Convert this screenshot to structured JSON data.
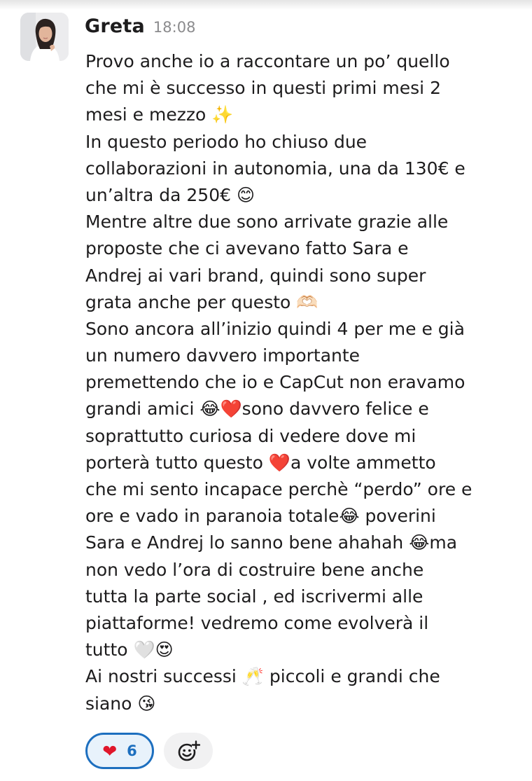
{
  "message": {
    "sender": "Greta",
    "time": "18:08",
    "lines": [
      "Provo anche io a raccontare un po’ quello",
      "che mi è successo in questi primi mesi 2",
      "mesi e mezzo ✨",
      "In questo periodo ho chiuso due",
      "collaborazioni in autonomia, una da 130€ e",
      "un’altra da 250€ 😊",
      "Mentre altre due sono arrivate grazie alle",
      "proposte che ci avevano fatto Sara e",
      "Andrej ai vari brand, quindi sono super",
      "grata anche per questo 🫶🏻",
      "Sono ancora all’inizio quindi 4 per me e già",
      "un numero davvero importante",
      "premettendo che io e CapCut non eravamo",
      "grandi amici 😂❤️sono davvero felice e",
      "soprattutto curiosa di vedere dove mi",
      "porterà tutto questo ❤️a volte ammetto",
      "che mi sento incapace perchè “perdo” ore e",
      "ore e vado in paranoia totale😂 poverini",
      "Sara e Andrej lo sanno bene ahahah 😂ma",
      "non vedo l’ora di costruire bene anche",
      "tutta la parte social , ed iscrivermi alle",
      "piattaforme! vedremo come evolverà il",
      "tutto 🤍😍",
      "Ai nostri successi 🥂 piccoli e grandi che",
      "siano 😘"
    ]
  },
  "reactions": {
    "heart": {
      "emoji": "❤",
      "count": "6",
      "icon": "heart-icon"
    },
    "add_icon": "add-reaction-icon"
  },
  "colors": {
    "text": "#1d1c1d",
    "timestamp": "#8b8b8d",
    "reaction_border": "#1d6fbf",
    "reaction_bg": "#e8f2fb"
  }
}
